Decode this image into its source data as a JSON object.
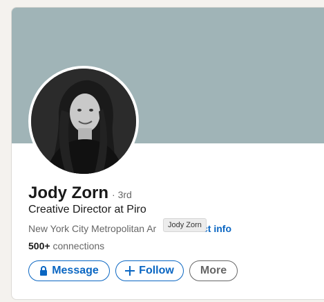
{
  "profile": {
    "name": "Jody Zorn",
    "degree": "· 3rd",
    "headline": "Creative Director at Piro",
    "location": "New York City Metropolitan Ar",
    "contact_info": "ct info",
    "tooltip": "Jody Zorn",
    "connections_count": "500+",
    "connections_label": "connections"
  },
  "actions": {
    "message": "Message",
    "follow": "Follow",
    "more": "More"
  },
  "colors": {
    "banner": "#a0b4b7",
    "accent": "#0a66c2",
    "text_primary": "#191919",
    "text_secondary": "#666666"
  }
}
